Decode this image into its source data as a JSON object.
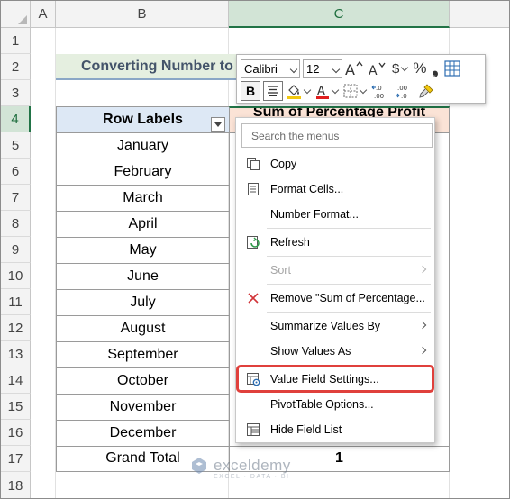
{
  "sheet": {
    "columns": [
      "A",
      "B",
      "C"
    ],
    "rows": [
      "1",
      "2",
      "3",
      "4",
      "5",
      "6",
      "7",
      "8",
      "9",
      "10",
      "11",
      "12",
      "13",
      "14",
      "15",
      "16",
      "17",
      "18"
    ],
    "selected_column": "C",
    "selected_row": "4"
  },
  "banner": {
    "text": "Converting Number to"
  },
  "pivot": {
    "header_labels": "Row Labels",
    "header_values": "Sum of Percentage Profit",
    "months": [
      "January",
      "February",
      "March",
      "April",
      "May",
      "June",
      "July",
      "August",
      "September",
      "October",
      "November",
      "December"
    ],
    "grand_total_label": "Grand Total",
    "grand_total_value": "1"
  },
  "mini_toolbar": {
    "font_name": "Calibri",
    "font_size": "12",
    "grow_font": "A^",
    "shrink_font": "Aˇ",
    "currency": "$",
    "percent": "%",
    "comma": "❟",
    "bold": "B",
    "inc_decimal": "←.0 .00",
    "dec_decimal": ".00 →.0"
  },
  "context_menu": {
    "search_placeholder": "Search the menus",
    "items": {
      "copy": "Copy",
      "format_cells": "Format Cells...",
      "number_format": "Number Format...",
      "refresh": "Refresh",
      "sort": "Sort",
      "remove": "Remove \"Sum of Percentage...",
      "summarize": "Summarize Values By",
      "show_values": "Show Values As",
      "value_field": "Value Field Settings...",
      "pivot_options": "PivotTable Options...",
      "hide_field": "Hide Field List"
    }
  },
  "watermark": {
    "name": "exceldemy",
    "tagline": "EXCEL · DATA · BI"
  },
  "colors": {
    "header_blue": "#dde8f5",
    "header_peach": "#fbe3d6",
    "banner_green": "#e5efe0",
    "excel_green": "#217346",
    "highlight_red": "#e0403c"
  }
}
